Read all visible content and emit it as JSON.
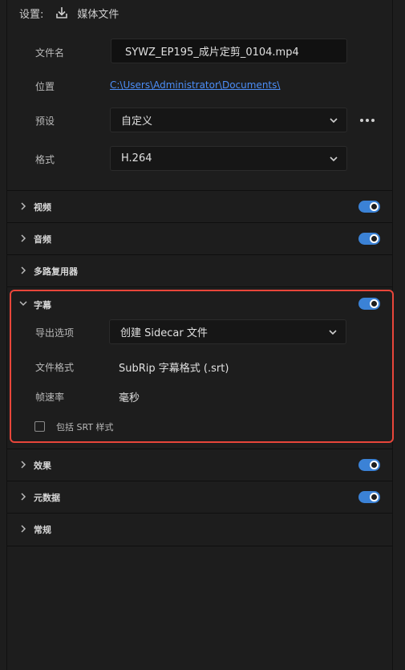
{
  "header": {
    "settings_label": "设置:",
    "media_label": "媒体文件"
  },
  "file": {
    "name_label": "文件名",
    "name_value": "SYWZ_EP195_成片定剪_0104.mp4",
    "location_label": "位置",
    "location_value": "C:\\Users\\Administrator\\Documents\\",
    "preset_label": "预设",
    "preset_value": "自定义",
    "format_label": "格式",
    "format_value": "H.264"
  },
  "sections": {
    "video": {
      "title": "视频",
      "enabled": true
    },
    "audio": {
      "title": "音频",
      "enabled": true
    },
    "mux": {
      "title": "多路复用器"
    },
    "captions": {
      "title": "字幕",
      "enabled": true
    },
    "effects": {
      "title": "效果",
      "enabled": true
    },
    "metadata": {
      "title": "元数据",
      "enabled": true
    },
    "general": {
      "title": "常规"
    }
  },
  "captions": {
    "export_option_label": "导出选项",
    "export_option_value": "创建 Sidecar 文件",
    "file_format_label": "文件格式",
    "file_format_value": "SubRip 字幕格式 (.srt)",
    "frame_rate_label": "帧速率",
    "frame_rate_value": "毫秒",
    "include_srt_label": "包括 SRT 样式",
    "include_srt_checked": false
  },
  "colors": {
    "accent": "#3b82d6",
    "highlight": "#e8463a",
    "link": "#4c8ef7"
  }
}
